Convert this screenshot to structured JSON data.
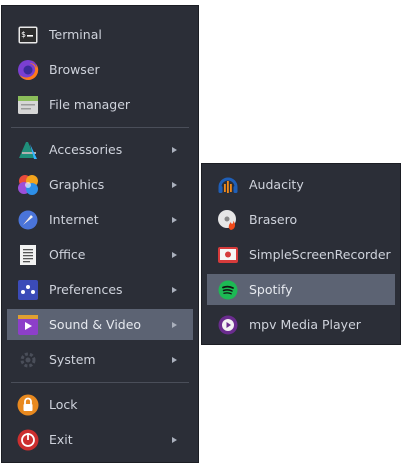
{
  "main_menu": {
    "items": [
      {
        "label": "Terminal",
        "icon": "terminal-icon"
      },
      {
        "label": "Browser",
        "icon": "firefox-icon"
      },
      {
        "label": "File manager",
        "icon": "file-manager-icon"
      },
      {
        "label": "Accessories",
        "icon": "accessories-icon"
      },
      {
        "label": "Graphics",
        "icon": "graphics-icon"
      },
      {
        "label": "Internet",
        "icon": "internet-icon"
      },
      {
        "label": "Office",
        "icon": "office-icon"
      },
      {
        "label": "Preferences",
        "icon": "preferences-icon"
      },
      {
        "label": "Sound & Video",
        "icon": "sound-video-icon"
      },
      {
        "label": "System",
        "icon": "system-icon"
      },
      {
        "label": "Lock",
        "icon": "lock-icon"
      },
      {
        "label": "Exit",
        "icon": "exit-icon"
      }
    ]
  },
  "submenu": {
    "items": [
      {
        "label": "Audacity",
        "icon": "audacity-icon"
      },
      {
        "label": "Brasero",
        "icon": "brasero-icon"
      },
      {
        "label": "SimpleScreenRecorder",
        "icon": "screen-recorder-icon"
      },
      {
        "label": "Spotify",
        "icon": "spotify-icon"
      },
      {
        "label": "mpv Media Player",
        "icon": "mpv-icon"
      }
    ]
  },
  "colors": {
    "menu_bg": "#2b2e37",
    "highlight": "#5c6373",
    "text": "#cfd3dc"
  }
}
